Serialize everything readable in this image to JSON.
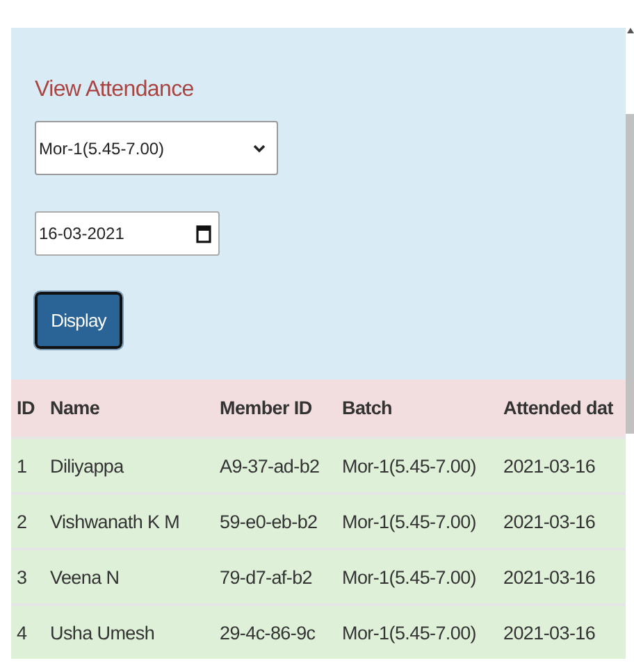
{
  "title": "View Attendance",
  "batch_select": {
    "value": "Mor-1(5.45-7.00)"
  },
  "date_field": {
    "value": "16-03-2021"
  },
  "display_button": "Display",
  "table": {
    "columns": [
      "ID",
      "Name",
      "Member ID",
      "Batch",
      "Attended dat"
    ],
    "rows": [
      [
        "1",
        "Diliyappa",
        "A9-37-ad-b2",
        "Mor-1(5.45-7.00)",
        "2021-03-16"
      ],
      [
        "2",
        "Vishwanath K M",
        "59-e0-eb-b2",
        "Mor-1(5.45-7.00)",
        "2021-03-16"
      ],
      [
        "3",
        "Veena N",
        "79-d7-af-b2",
        "Mor-1(5.45-7.00)",
        "2021-03-16"
      ],
      [
        "4",
        "Usha Umesh",
        "29-4c-86-9c",
        "Mor-1(5.45-7.00)",
        "2021-03-16"
      ]
    ]
  }
}
